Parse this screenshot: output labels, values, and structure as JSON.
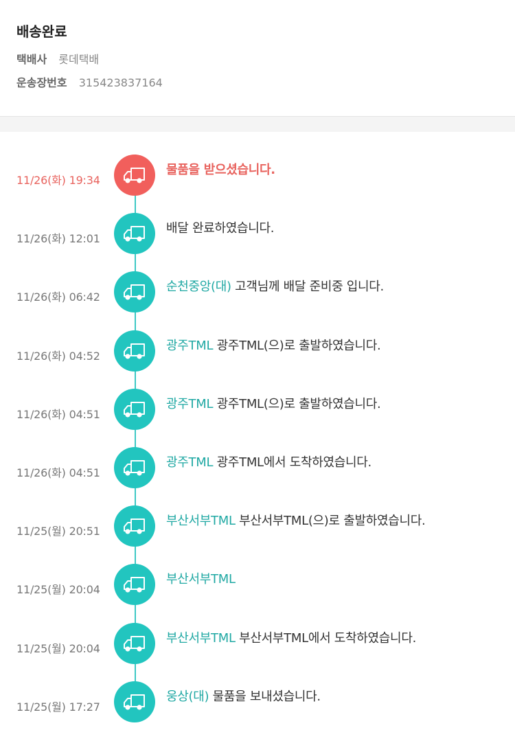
{
  "header": {
    "status": "배송완료",
    "carrier_label": "택배사",
    "carrier_value": "롯데택배",
    "tracking_label": "운송장번호",
    "tracking_value": "315423837164"
  },
  "colors": {
    "accent": "#22c5bf",
    "current": "#f15f5c",
    "location_text": "#1fa8a3"
  },
  "events": [
    {
      "time": "11/26(화) 19:34",
      "location": "",
      "message": "물품을 받으셨습니다.",
      "icon": "truck-icon",
      "current": true
    },
    {
      "time": "11/26(화) 12:01",
      "location": "",
      "message": "배달 완료하였습니다.",
      "icon": "truck-icon"
    },
    {
      "time": "11/26(화) 06:42",
      "location": "순천중앙(대)",
      "message": "고객님께 배달 준비중 입니다.",
      "icon": "truck-icon"
    },
    {
      "time": "11/26(화) 04:52",
      "location": "광주TML",
      "message": "광주TML(으)로 출발하였습니다.",
      "icon": "truck-icon"
    },
    {
      "time": "11/26(화) 04:51",
      "location": "광주TML",
      "message": "광주TML(으)로 출발하였습니다.",
      "icon": "truck-icon"
    },
    {
      "time": "11/26(화) 04:51",
      "location": "광주TML",
      "message": "광주TML에서 도착하였습니다.",
      "icon": "truck-icon"
    },
    {
      "time": "11/25(월) 20:51",
      "location": "부산서부TML",
      "message": "부산서부TML(으)로 출발하였습니다.",
      "icon": "truck-icon"
    },
    {
      "time": "11/25(월) 20:04",
      "location": "부산서부TML",
      "message": "",
      "icon": "truck-icon"
    },
    {
      "time": "11/25(월) 20:04",
      "location": "부산서부TML",
      "message": "부산서부TML에서 도착하였습니다.",
      "icon": "truck-icon"
    },
    {
      "time": "11/25(월) 17:27",
      "location": "웅상(대)",
      "message": "물품을 보내셨습니다.",
      "icon": "truck-icon"
    }
  ]
}
